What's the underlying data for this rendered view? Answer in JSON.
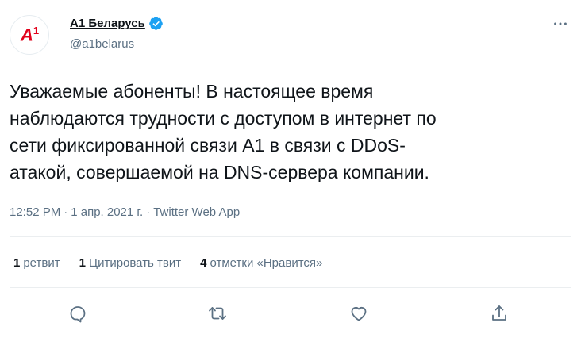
{
  "account": {
    "display_name": "A1 Беларусь",
    "handle": "@a1belarus",
    "avatar_logo": "A1",
    "verified": true,
    "brand_color": "#e2001a",
    "verified_color": "#1da1f2"
  },
  "tweet": {
    "text": "Уважаемые абоненты! В настоящее время\nнаблюдаются трудности с доступом в интернет по\nсети фиксированной связи А1 в связи с DDoS-\nатакой, совершаемой на DNS-сервера компании.",
    "time": "12:52 PM",
    "date": "1 апр. 2021 г.",
    "source": "Twitter Web App",
    "separator": "·"
  },
  "stats": {
    "retweets_count": "1",
    "retweets_label": "ретвит",
    "quotes_count": "1",
    "quotes_label": "Цитировать твит",
    "likes_count": "4",
    "likes_label": "отметки «Нравится»"
  },
  "icons": {
    "more": "more-icon",
    "reply": "reply-icon",
    "retweet": "retweet-icon",
    "like": "heart-icon",
    "share": "share-icon",
    "verified": "verified-badge-icon"
  },
  "colors": {
    "text": "#0f1419",
    "secondary": "#5b7083",
    "divider": "#ebeef0"
  }
}
